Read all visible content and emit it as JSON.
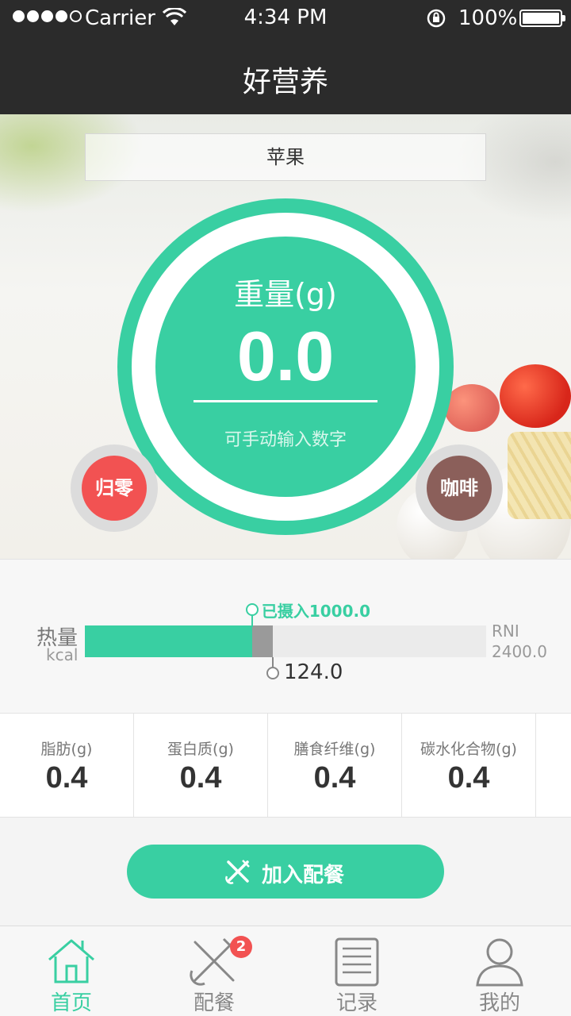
{
  "status_bar": {
    "carrier": "Carrier",
    "time": "4:34 PM",
    "battery": "100%",
    "signal_bars": 4,
    "signal_total": 5
  },
  "nav": {
    "title": "好营养"
  },
  "food": {
    "name": "苹果"
  },
  "scale": {
    "label": "重量(g)",
    "value": "0.0",
    "hint": "可手动输入数字"
  },
  "buttons": {
    "zero": "归零",
    "coffee": "咖啡",
    "add_to_meal": "加入配餐"
  },
  "calories": {
    "label": "热量",
    "unit": "kcal",
    "consumed_label": "已摄入1000.0",
    "consumed": 1000.0,
    "current": 124.0,
    "current_label": "124.0",
    "rni_label": "RNI",
    "rni_value": "2400.0",
    "rni": 2400.0
  },
  "nutrients": [
    {
      "name": "脂肪(g)",
      "value": "0.4"
    },
    {
      "name": "蛋白质(g)",
      "value": "0.4"
    },
    {
      "name": "膳食纤维(g)",
      "value": "0.4"
    },
    {
      "name": "碳水化合物(g)",
      "value": "0.4"
    }
  ],
  "tabs": [
    {
      "label": "首页",
      "icon": "home-icon",
      "active": true
    },
    {
      "label": "配餐",
      "icon": "fork-knife-icon",
      "badge": "2"
    },
    {
      "label": "记录",
      "icon": "list-icon"
    },
    {
      "label": "我的",
      "icon": "user-icon"
    }
  ],
  "colors": {
    "accent": "#39cfa2",
    "danger": "#f25252",
    "coffee": "#8b5f5a",
    "dark": "#2b2b2b"
  }
}
